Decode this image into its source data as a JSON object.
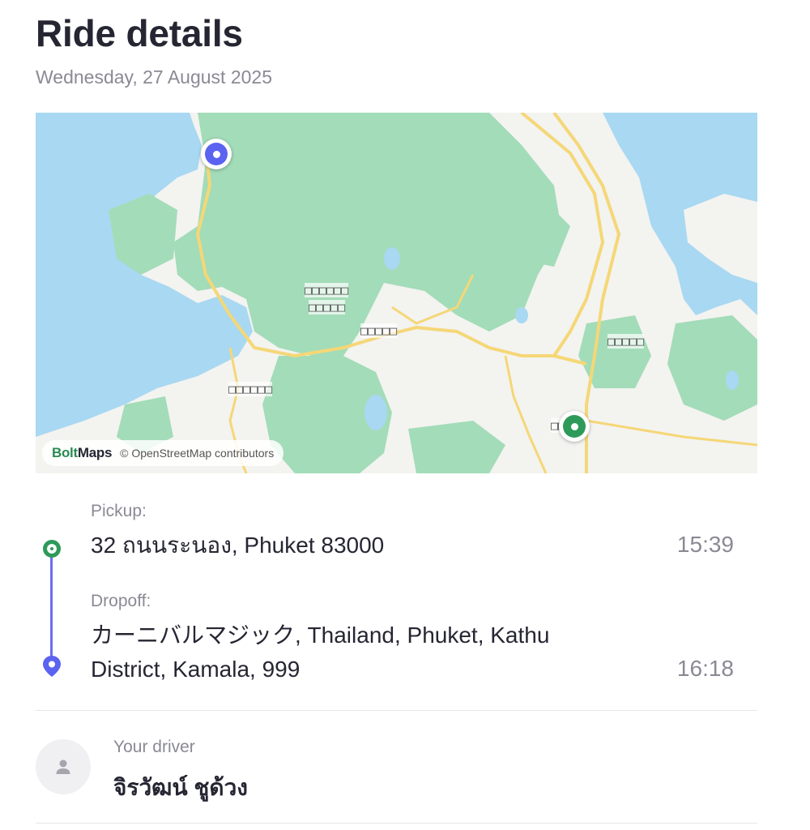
{
  "header": {
    "title": "Ride details",
    "date": "Wednesday, 27 August 2025"
  },
  "map": {
    "brand_bolt": "Bolt",
    "brand_maps": "Maps",
    "attribution": "© OpenStreetMap contributors",
    "place_labels": [
      "□□□□□□",
      "□□□□□",
      "□□□□□",
      "□□□□□□",
      "□□□□□",
      "□□□□□"
    ],
    "colors": {
      "water": "#a8d8f2",
      "land": "#f3f3f0",
      "forest": "#a3dcb8",
      "road": "#f5d777",
      "pickup": "#2e9a5a",
      "dropoff": "#5b63f0"
    }
  },
  "trip": {
    "pickup_label": "Pickup:",
    "pickup_address": "32 ถนนระนอง, Phuket 83000",
    "pickup_time": "15:39",
    "dropoff_label": "Dropoff:",
    "dropoff_address_line1": "カーニバルマジック, Thailand, Phuket, Kathu",
    "dropoff_address_line2": "District, Kamala, 999",
    "dropoff_time": "16:18"
  },
  "driver": {
    "label": "Your driver",
    "name": "จิรวัฒน์ ชูด้วง",
    "avatar_icon": "person-icon"
  }
}
